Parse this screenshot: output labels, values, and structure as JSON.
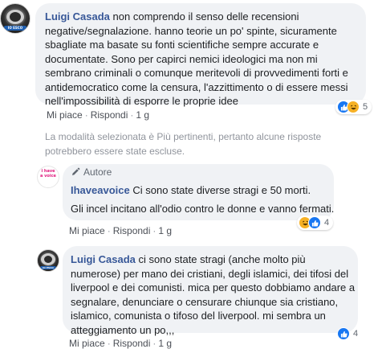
{
  "thread": {
    "notice": "La modalità selezionata è Più pertinenti, pertanto alcune risposte potrebbero essere state escluse."
  },
  "comments": [
    {
      "author": "Luigi Casada",
      "text": "non comprendo il senso delle recensioni negative/segnalazione. hanno teorie un po' spinte, sicuramente sbagliate ma basate su fonti scientifiche sempre accurate e documentate. Sono per capirci nemici ideologici ma non mi sembrano criminali o comunque meritevoli di provvedimenti forti e antidemocratico come la censura, l'azzittimento o di essere messi nell'impossibilità di esporre le proprie idee",
      "actions": {
        "like": "Mi piace",
        "reply": "Rispondi",
        "time": "1 g"
      },
      "reactions": {
        "types": [
          "like",
          "haha"
        ],
        "count": "5"
      },
      "avatar_tag": "IO ESCO"
    },
    {
      "badge": "Autore",
      "author": "Ihaveavoice",
      "text": "Ci sono state diverse stragi e 50 morti.",
      "text2": "Gli incel incitano all'odio contro le donne e vanno fermati.",
      "actions": {
        "like": "Mi piace",
        "reply": "Rispondi",
        "time": "1 g"
      },
      "reactions": {
        "types": [
          "haha",
          "like"
        ],
        "count": "4"
      },
      "avatar_logo": "i have a voice"
    },
    {
      "author": "Luigi Casada",
      "text": "ci sono state stragi (anche molto più numerose) per mano dei cristiani, degli islamici, dei tifosi del liverpool e dei comunisti. mica per questo dobbiamo andare a segnalare, denunciare o censurare chiunque sia cristiano, islamico, comunista o tifoso del liverpool. mi sembra un atteggiamento un po,,,",
      "actions": {
        "like": "Mi piace",
        "reply": "Rispondi",
        "time": "1 g"
      },
      "reactions": {
        "types": [
          "like"
        ],
        "count": "4"
      },
      "avatar_tag": "IO ESCO"
    }
  ],
  "colors": {
    "author": "#385898",
    "bubble": "#f0f2f5",
    "like": "#1877f2",
    "haha": "#f7b125"
  }
}
